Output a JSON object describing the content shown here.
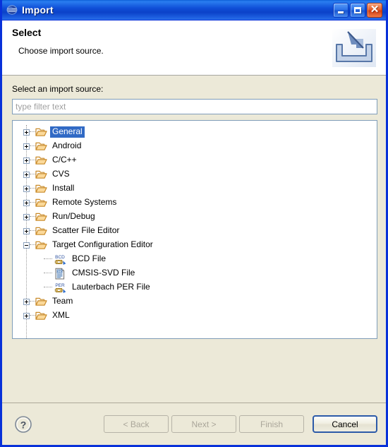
{
  "window": {
    "title": "Import",
    "app_icon": "eclipse-globe-icon",
    "minimize_label": "Minimize",
    "maximize_label": "Maximize",
    "close_label": "Close",
    "close_glyph": "✕"
  },
  "header": {
    "title": "Select",
    "subtitle": "Choose import source.",
    "icon": "import-arrow-tray-icon"
  },
  "form": {
    "source_label": "Select an import source:",
    "filter_placeholder": "type filter text",
    "filter_value": ""
  },
  "tree": {
    "selected": "General",
    "nodes": [
      {
        "label": "General",
        "icon": "folder-icon",
        "state": "collapsed",
        "level": 0,
        "selected": true
      },
      {
        "label": "Android",
        "icon": "folder-icon",
        "state": "collapsed",
        "level": 0,
        "selected": false
      },
      {
        "label": "C/C++",
        "icon": "folder-icon",
        "state": "collapsed",
        "level": 0,
        "selected": false
      },
      {
        "label": "CVS",
        "icon": "folder-icon",
        "state": "collapsed",
        "level": 0,
        "selected": false
      },
      {
        "label": "Install",
        "icon": "folder-icon",
        "state": "collapsed",
        "level": 0,
        "selected": false
      },
      {
        "label": "Remote Systems",
        "icon": "folder-icon",
        "state": "collapsed",
        "level": 0,
        "selected": false
      },
      {
        "label": "Run/Debug",
        "icon": "folder-icon",
        "state": "collapsed",
        "level": 0,
        "selected": false
      },
      {
        "label": "Scatter File Editor",
        "icon": "folder-icon",
        "state": "collapsed",
        "level": 0,
        "selected": false
      },
      {
        "label": "Target Configuration Editor",
        "icon": "folder-icon",
        "state": "expanded",
        "level": 0,
        "selected": false
      },
      {
        "label": "BCD File",
        "icon": "bcd-file-icon",
        "state": "leaf",
        "level": 1,
        "selected": false
      },
      {
        "label": "CMSIS-SVD File",
        "icon": "svd-document-icon",
        "state": "leaf",
        "level": 1,
        "selected": false
      },
      {
        "label": "Lauterbach PER File",
        "icon": "per-file-icon",
        "state": "leaf",
        "level": 1,
        "selected": false
      },
      {
        "label": "Team",
        "icon": "folder-icon",
        "state": "collapsed",
        "level": 0,
        "selected": false
      },
      {
        "label": "XML",
        "icon": "folder-icon",
        "state": "collapsed",
        "level": 0,
        "selected": false
      }
    ]
  },
  "footer": {
    "help_icon": "question-mark-help-icon",
    "back_label": "< Back",
    "next_label": "Next >",
    "finish_label": "Finish",
    "cancel_label": "Cancel",
    "back_enabled": false,
    "next_enabled": false,
    "finish_enabled": false,
    "cancel_enabled": true
  },
  "colors": {
    "titlebar_blue": "#0831d9",
    "selection_blue": "#316ac5",
    "dialog_bg": "#ece9d8",
    "field_border": "#7f9db9",
    "close_red": "#cf3c12"
  }
}
